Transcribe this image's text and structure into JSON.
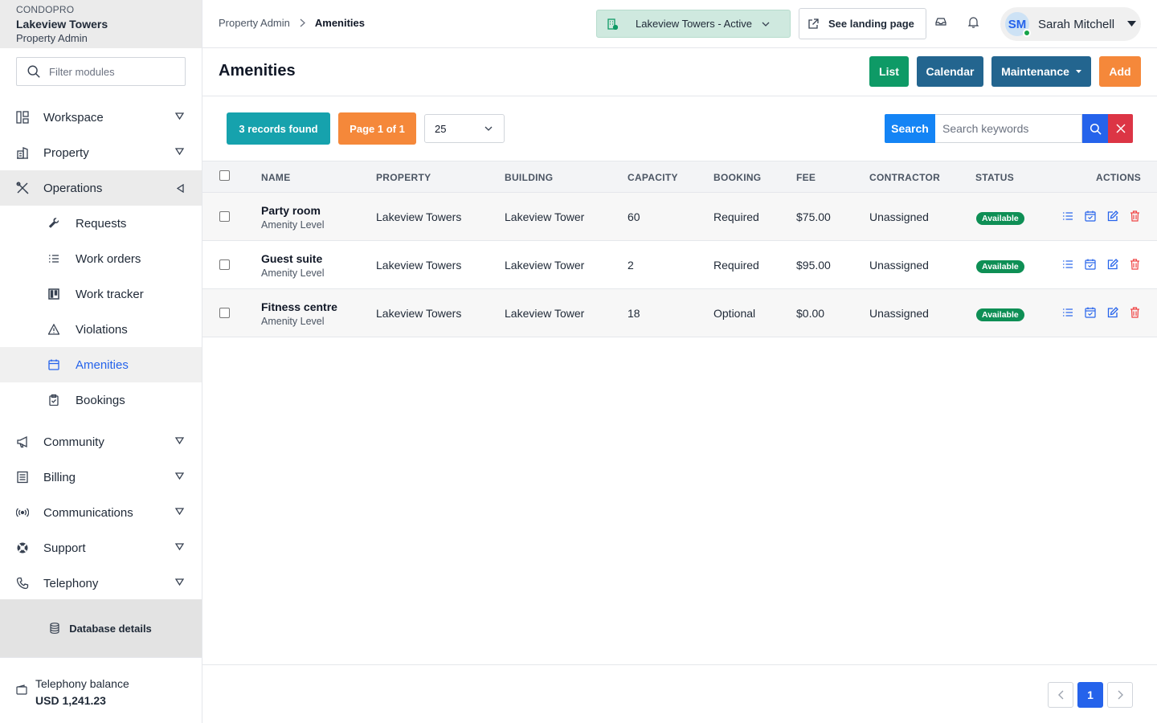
{
  "app": {
    "org": "CONDOPRO",
    "property": "Lakeview Towers",
    "role": "Property Admin"
  },
  "sidebar": {
    "filter_placeholder": "Filter modules",
    "sections": [
      {
        "label": "Workspace",
        "icon": "layout-icon"
      },
      {
        "label": "Property",
        "icon": "building-icon"
      },
      {
        "label": "Operations",
        "icon": "tools-icon"
      }
    ],
    "operations_items": [
      {
        "label": "Requests",
        "icon": "wrench-icon"
      },
      {
        "label": "Work orders",
        "icon": "list-icon"
      },
      {
        "label": "Work tracker",
        "icon": "kanban-icon"
      },
      {
        "label": "Violations",
        "icon": "warning-icon"
      },
      {
        "label": "Amenities",
        "icon": "calendar-icon"
      },
      {
        "label": "Bookings",
        "icon": "clipboard-icon"
      }
    ],
    "more_sections": [
      {
        "label": "Community",
        "icon": "megaphone-icon"
      },
      {
        "label": "Billing",
        "icon": "receipt-icon"
      },
      {
        "label": "Communications",
        "icon": "broadcast-icon"
      },
      {
        "label": "Support",
        "icon": "lifebuoy-icon"
      },
      {
        "label": "Telephony",
        "icon": "phone-icon"
      }
    ],
    "database_details": "Database details",
    "telephony_balance_label": "Telephony balance",
    "telephony_balance_value": "USD 1,241.23"
  },
  "topbar": {
    "breadcrumb_root": "Property Admin",
    "breadcrumb_current": "Amenities",
    "property_selector": "Lakeview Towers - Active",
    "landing_page": "See landing page",
    "user_initials": "SM",
    "user_name": "Sarah Mitchell"
  },
  "header": {
    "title": "Amenities",
    "buttons": {
      "list": "List",
      "calendar": "Calendar",
      "maintenance": "Maintenance",
      "add": "Add"
    }
  },
  "toolbar": {
    "records": "3 records found",
    "page": "Page 1 of 1",
    "per_page": "25",
    "search_label": "Search",
    "search_placeholder": "Search keywords"
  },
  "table": {
    "columns": [
      "NAME",
      "PROPERTY",
      "BUILDING",
      "CAPACITY",
      "BOOKING",
      "FEE",
      "CONTRACTOR",
      "STATUS",
      "ACTIONS"
    ],
    "rows": [
      {
        "name": "Party room",
        "sub": "Amenity Level",
        "property": "Lakeview Towers",
        "building": "Lakeview Tower",
        "capacity": "60",
        "booking": "Required",
        "fee": "$75.00",
        "contractor": "Unassigned",
        "status": "Available"
      },
      {
        "name": "Guest suite",
        "sub": "Amenity Level",
        "property": "Lakeview Towers",
        "building": "Lakeview Tower",
        "capacity": "2",
        "booking": "Required",
        "fee": "$95.00",
        "contractor": "Unassigned",
        "status": "Available"
      },
      {
        "name": "Fitness centre",
        "sub": "Amenity Level",
        "property": "Lakeview Towers",
        "building": "Lakeview Tower",
        "capacity": "18",
        "booking": "Optional",
        "fee": "$0.00",
        "contractor": "Unassigned",
        "status": "Available"
      }
    ]
  },
  "pagination": {
    "current": "1"
  },
  "colors": {
    "accent": "#2563eb",
    "success": "#0e9a66",
    "brand": "#23658f",
    "warning": "#f5883a",
    "danger": "#dc3545",
    "info": "#16a2ad"
  }
}
